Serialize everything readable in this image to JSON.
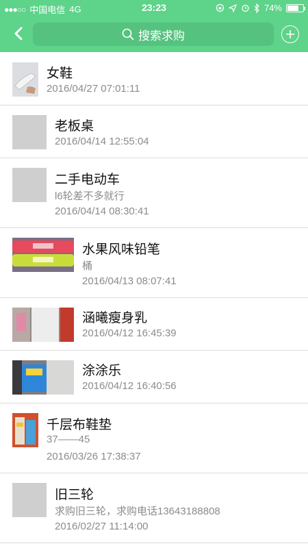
{
  "status_bar": {
    "signal": "●●●○○",
    "carrier": "中国电信",
    "network": "4G",
    "time": "23:23",
    "battery": "74%",
    "battery_level": 0.74
  },
  "nav": {
    "search_label": "搜索求购"
  },
  "items": [
    {
      "title": "女鞋",
      "subtitle": "",
      "time": "2016/04/27 07:01:11",
      "thumb": "shoe-photo"
    },
    {
      "title": "老板桌",
      "subtitle": "",
      "time": "2016/04/14 12:55:04",
      "thumb": "placeholder"
    },
    {
      "title": "二手电动车",
      "subtitle": "l6轮差不多就行",
      "time": "2016/04/14 08:30:41",
      "thumb": "placeholder"
    },
    {
      "title": "水果风味铅笔",
      "subtitle": "桶",
      "time": "2016/04/13 08:07:41",
      "thumb": "pencil-photo"
    },
    {
      "title": "涵曦瘦身乳",
      "subtitle": "",
      "time": "2016/04/12 16:45:39",
      "thumb": "cream-photo"
    },
    {
      "title": "涂涂乐",
      "subtitle": "",
      "time": "2016/04/12 16:40:56",
      "thumb": "toy-photo"
    },
    {
      "title": "千层布鞋垫",
      "subtitle": "37——45",
      "time": "2016/03/26 17:38:37",
      "thumb": "insole-photo"
    },
    {
      "title": "旧三轮",
      "subtitle": "求购旧三轮，求购电话13643188808",
      "time": "2016/02/27 11:14:00",
      "thumb": "placeholder"
    }
  ]
}
